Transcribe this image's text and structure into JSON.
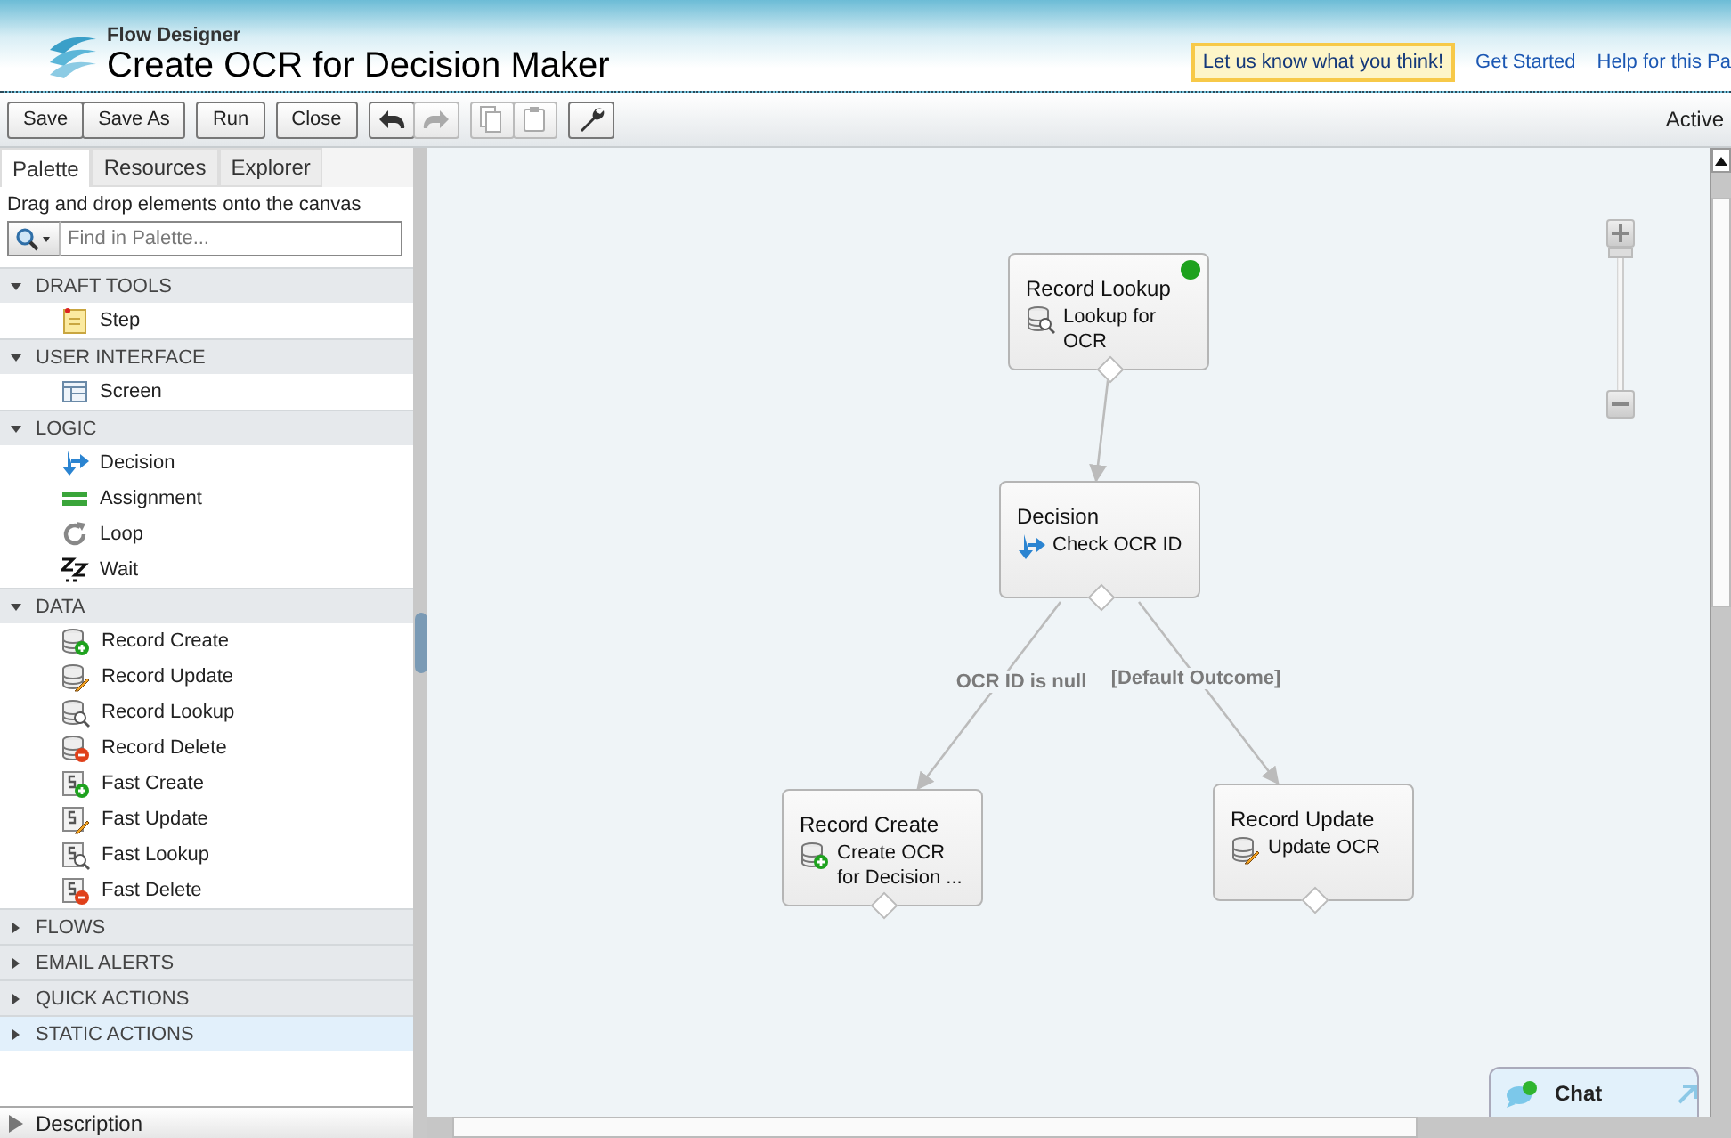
{
  "header": {
    "app": "Flow Designer",
    "title": "Create OCR for Decision Maker",
    "feedback": "Let us know what you think!",
    "links": [
      "Get Started",
      "Help for this Pa"
    ]
  },
  "toolbar": {
    "groups": [
      [
        {
          "kind": "text",
          "label": "Save",
          "disabled": false
        },
        {
          "kind": "text",
          "label": "Save As",
          "disabled": false
        }
      ],
      [
        {
          "kind": "text",
          "label": "Run",
          "disabled": false
        }
      ],
      [
        {
          "kind": "text",
          "label": "Close",
          "disabled": false
        }
      ],
      [
        {
          "kind": "undo",
          "disabled": false
        },
        {
          "kind": "redo",
          "disabled": true
        }
      ],
      [
        {
          "kind": "copy",
          "disabled": true
        },
        {
          "kind": "paste",
          "disabled": true
        }
      ],
      [
        {
          "kind": "wrench",
          "disabled": false
        }
      ]
    ],
    "status": "Active"
  },
  "sidebar": {
    "tabs": [
      {
        "label": "Palette",
        "selected": true
      },
      {
        "label": "Resources",
        "selected": false
      },
      {
        "label": "Explorer",
        "selected": false
      }
    ],
    "hint": "Drag and drop elements onto the canvas",
    "search": {
      "placeholder": "Find in Palette..."
    },
    "sections": [
      {
        "label": "DRAFT TOOLS",
        "expanded": true,
        "selected": false,
        "items": [
          {
            "label": "Step",
            "kind": "step"
          }
        ]
      },
      {
        "label": "USER INTERFACE",
        "expanded": true,
        "selected": false,
        "items": [
          {
            "label": "Screen",
            "kind": "screen"
          }
        ]
      },
      {
        "label": "LOGIC",
        "expanded": true,
        "selected": false,
        "items": [
          {
            "label": "Decision",
            "kind": "decision"
          },
          {
            "label": "Assignment",
            "kind": "assignment"
          },
          {
            "label": "Loop",
            "kind": "loop"
          },
          {
            "label": "Wait",
            "kind": "wait"
          }
        ]
      },
      {
        "label": "DATA",
        "expanded": true,
        "selected": false,
        "items": [
          {
            "label": "Record Create",
            "kind": "db-create"
          },
          {
            "label": "Record Update",
            "kind": "db-update"
          },
          {
            "label": "Record Lookup",
            "kind": "db-lookup"
          },
          {
            "label": "Record Delete",
            "kind": "db-delete"
          },
          {
            "label": "Fast Create",
            "kind": "s-create"
          },
          {
            "label": "Fast Update",
            "kind": "s-update"
          },
          {
            "label": "Fast Lookup",
            "kind": "s-lookup"
          },
          {
            "label": "Fast Delete",
            "kind": "s-delete"
          }
        ]
      },
      {
        "label": "FLOWS",
        "expanded": false,
        "selected": false
      },
      {
        "label": "EMAIL ALERTS",
        "expanded": false,
        "selected": false
      },
      {
        "label": "QUICK ACTIONS",
        "expanded": false,
        "selected": false
      },
      {
        "label": "STATIC ACTIONS",
        "expanded": false,
        "selected": true
      }
    ],
    "description": {
      "label": "Description",
      "expanded": false
    }
  },
  "canvas": {
    "zoom": {
      "level": 1
    },
    "nodes": [
      {
        "type": "Record Lookup",
        "name": "Lookup for OCR",
        "kind": "db-lookup",
        "start": true
      },
      {
        "type": "Decision",
        "name": "Check OCR ID",
        "kind": "decision",
        "start": false
      },
      {
        "type": "Record Create",
        "name": "Create OCR for Decision ...",
        "kind": "db-create",
        "start": false,
        "outcome": "OCR ID is null"
      },
      {
        "type": "Record Update",
        "name": "Update OCR",
        "kind": "db-update",
        "start": false,
        "outcome": "[Default Outcome]"
      }
    ]
  },
  "chat": {
    "label": "Chat"
  }
}
